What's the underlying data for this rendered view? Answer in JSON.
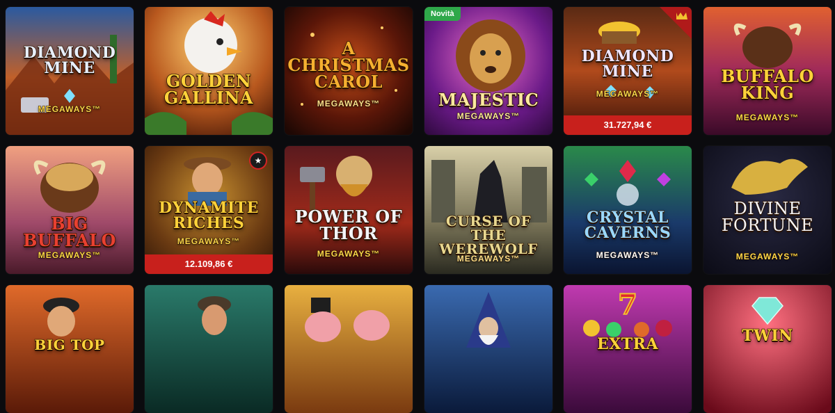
{
  "tiles": [
    {
      "title": "DIAMOND MINE",
      "subtitle": "MEGAWAYS™"
    },
    {
      "title": "GOLDEN GALLINA",
      "subtitle": ""
    },
    {
      "title": "A CHRISTMAS CAROL",
      "subtitle": "MEGAWAYS™"
    },
    {
      "title": "MAJESTIC",
      "subtitle": "MEGAWAYS™",
      "badge": "Novità"
    },
    {
      "title": "DIAMOND MINE",
      "subtitle": "MEGAWAYS™",
      "jackpot": "31.727,94 €"
    },
    {
      "title": "BUFFALO KING",
      "subtitle": "MEGAWAYS™"
    },
    {
      "title": "BIG BUFFALO",
      "subtitle": "MEGAWAYS™"
    },
    {
      "title": "DYNAMITE RICHES",
      "subtitle": "MEGAWAYS™",
      "jackpot": "12.109,86 €"
    },
    {
      "title": "POWER OF THOR",
      "subtitle": "MEGAWAYS™"
    },
    {
      "title": "CURSE OF THE WEREWOLF",
      "subtitle": "MEGAWAYS™"
    },
    {
      "title": "CRYSTAL CAVERNS",
      "subtitle": "MEGAWAYS™"
    },
    {
      "title": "DIVINE FORTUNE",
      "subtitle": "MEGAWAYS™"
    },
    {
      "title": "BIG TOP",
      "subtitle": ""
    },
    {
      "title": "",
      "subtitle": ""
    },
    {
      "title": "",
      "subtitle": ""
    },
    {
      "title": "",
      "subtitle": ""
    },
    {
      "title": "EXTRA",
      "subtitle": ""
    },
    {
      "title": "TWIN",
      "subtitle": ""
    }
  ],
  "colors": {
    "jackpot_bar": "#c8201c",
    "new_badge": "#2fa84a",
    "page_bg": "#0b0b0e"
  }
}
